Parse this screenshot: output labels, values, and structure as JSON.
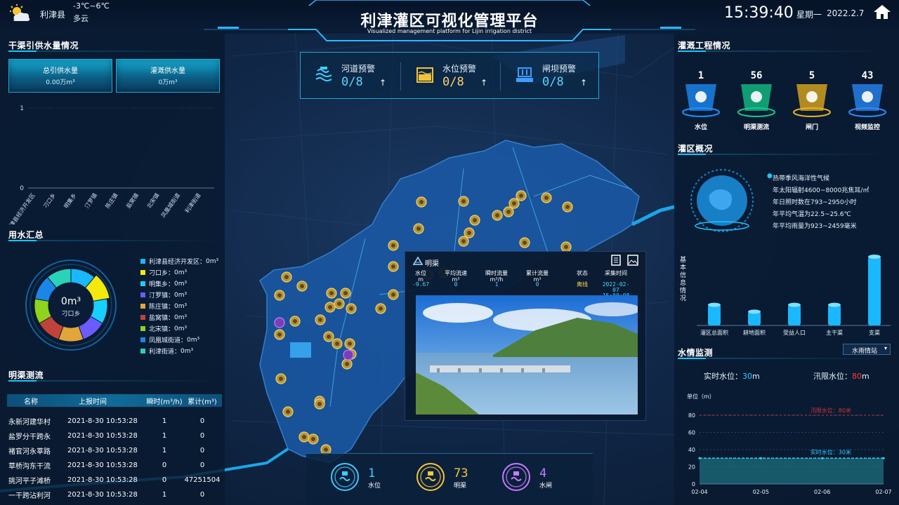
{
  "header": {
    "location": "利津县",
    "temperature": "-3℃~6℃",
    "weather": "多云",
    "title": "利津灌区可视化管理平台",
    "subtitle": "Visualized management platform for Lijin irrigation district",
    "time": "15:39:40",
    "weekday": "星期一",
    "date": "2022.2.7"
  },
  "supply": {
    "title": "干渠引供水量情况",
    "tabs": [
      {
        "label": "总引供水量",
        "value": "0.00万m³"
      },
      {
        "label": "灌溉供水量",
        "value": "0万m³"
      }
    ],
    "chart": {
      "y_ticks": [
        "1",
        "0"
      ],
      "categories": [
        "利津县经济开发区",
        "刁口乡",
        "明集乡",
        "汀罗镇",
        "陈庄镇",
        "盐窝镇",
        "北宋镇",
        "凤凰城街道",
        "利津街道"
      ]
    }
  },
  "usage": {
    "title": "用水汇总",
    "center_value": "0m³",
    "center_label": "刁口乡",
    "legend": [
      {
        "label": "利津县经济开发区：",
        "value": "0m³",
        "color": "#19b8ff"
      },
      {
        "label": "刁口乡：",
        "value": "0m³",
        "color": "#f2ea0a"
      },
      {
        "label": "明集乡：",
        "value": "0m³",
        "color": "#16d0ff"
      },
      {
        "label": "汀罗镇：",
        "value": "0m³",
        "color": "#6a5cff"
      },
      {
        "label": "陈庄镇：",
        "value": "0m³",
        "color": "#e2a53a"
      },
      {
        "label": "盐窝镇：",
        "value": "0m³",
        "color": "#c2423a"
      },
      {
        "label": "北宋镇：",
        "value": "0m³",
        "color": "#8ed31c"
      },
      {
        "label": "凤凰城街道：",
        "value": "0m³",
        "color": "#1a86e8"
      },
      {
        "label": "利津街道：",
        "value": "0m³",
        "color": "#2ad2b8"
      }
    ]
  },
  "flow": {
    "title": "明渠测流",
    "headers": [
      "名称",
      "上报时间",
      "瞬时(m³/h)",
      "累计(m³)"
    ],
    "rows": [
      [
        "永新河建华村",
        "2021-8-30 10:53:28",
        "1",
        "0"
      ],
      [
        "盐罗分干跨永",
        "2021-8-30 10:53:28",
        "1",
        "0"
      ],
      [
        "褚官河永莘路",
        "2021-8-30 10:53:28",
        "1",
        "0"
      ],
      [
        "草桥沟东干流",
        "2021-8-30 10:53:28",
        "0",
        "0"
      ],
      [
        "挑河平子滩桥",
        "2021-8-30 10:53:28",
        "0",
        "47251504"
      ],
      [
        "一干跨沾利河",
        "2021-8-30 10:53:28",
        "1",
        "0"
      ]
    ]
  },
  "warnings": [
    {
      "label": "河道预警",
      "value": "0/8",
      "icon": "river-icon"
    },
    {
      "label": "水位预警",
      "value": "0/8",
      "icon": "water-level-icon"
    },
    {
      "label": "闸坝预警",
      "value": "0/8",
      "icon": "dam-icon"
    }
  ],
  "popup": {
    "title": "明渠",
    "headers": [
      "水位\nm",
      "平均流速\nm³",
      "瞬时流量\nm³/h",
      "累计流量\nm³",
      "状态",
      "采集时间"
    ],
    "values": [
      "-9.67",
      "0",
      "1",
      "0",
      "离线",
      "2022-02-07\n15:00:08"
    ]
  },
  "bottom": [
    {
      "value": "1",
      "label": "水位",
      "color": "#3fc8ff"
    },
    {
      "value": "73",
      "label": "明渠",
      "color": "#f4c63a"
    },
    {
      "value": "4",
      "label": "水闸",
      "color": "#c57bff"
    }
  ],
  "engineering": {
    "title": "灌溉工程情况",
    "items": [
      {
        "value": "1",
        "label": "水位",
        "color": "#1e90ff"
      },
      {
        "value": "56",
        "label": "明渠测流",
        "color": "#14c98a"
      },
      {
        "value": "5",
        "label": "闸门",
        "color": "#e9b21c"
      },
      {
        "value": "43",
        "label": "视频监控",
        "color": "#2a8cff"
      }
    ]
  },
  "overview": {
    "title": "灌区概况",
    "facts": [
      "热带季风海洋性气候",
      "年太阳辐射4600~8000兆焦耳/㎡",
      "年日照时数在793~2950小时",
      "年平均气温为22.5~25.6℃",
      "年平均雨量为923~2459毫米"
    ],
    "chart_label": "基本信息情况",
    "chart_data": {
      "type": "bar",
      "categories": [
        "灌区总面积",
        "耕地面积",
        "受益人口",
        "主干渠",
        "支渠"
      ],
      "values": [
        30,
        20,
        30,
        30,
        100
      ]
    }
  },
  "hydro": {
    "title": "水情监测",
    "select": "水雨情站",
    "current_label": "实时水位：",
    "current_value": "30",
    "current_unit": "m",
    "flood_label": "汛限水位：",
    "flood_value": "80",
    "flood_unit": "m",
    "unit": "单位（m）",
    "flood_line_label": "汛限水位：80米",
    "current_line_label": "实时水位：30米",
    "chart_data": {
      "type": "area",
      "x": [
        "02-04",
        "02-05",
        "02-06",
        "02-07"
      ],
      "y": [
        30,
        30,
        30,
        30
      ],
      "ylim": [
        0,
        80
      ],
      "yticks": [
        "80",
        "60",
        "40",
        "20",
        "0"
      ]
    }
  }
}
